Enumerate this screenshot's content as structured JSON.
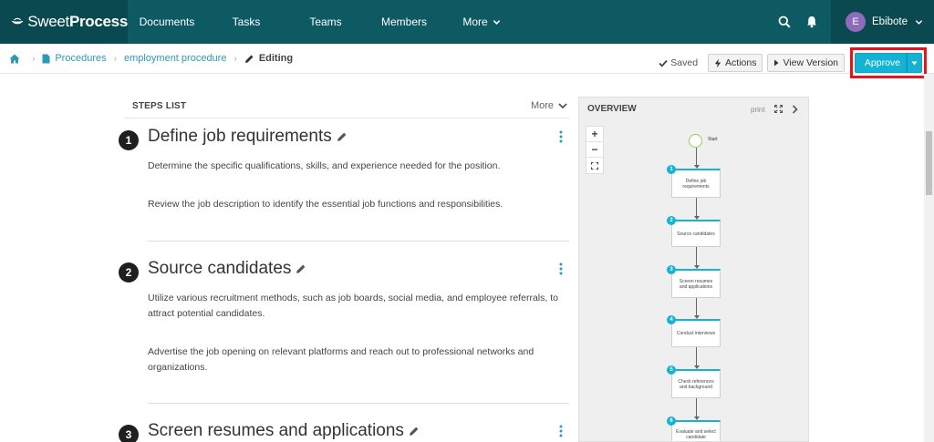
{
  "brand": {
    "name_part1": "Sweet",
    "name_part2": "Process"
  },
  "nav": {
    "documents": "Documents",
    "tasks": "Tasks",
    "teams": "Teams",
    "members": "Members",
    "more": "More"
  },
  "user": {
    "initial": "E",
    "name": "Ebibote"
  },
  "breadcrumb": {
    "procedures": "Procedures",
    "procedure": "employment procedure",
    "current": "Editing"
  },
  "toolbar": {
    "saved": "Saved",
    "actions": "Actions",
    "view_version": "View Version",
    "approve": "Approve"
  },
  "steps_list": {
    "title": "STEPS LIST",
    "more": "More",
    "steps": [
      {
        "number": "1",
        "title": "Define job requirements",
        "paragraphs": [
          "Determine the specific qualifications, skills, and experience needed for the position.",
          "Review the job description to identify the essential job functions and responsibilities."
        ]
      },
      {
        "number": "2",
        "title": "Source candidates",
        "paragraphs": [
          "Utilize various recruitment methods, such as job boards, social media, and employee referrals, to attract potential candidates.",
          "Advertise the job opening on relevant platforms and reach out to professional networks and organizations."
        ]
      },
      {
        "number": "3",
        "title": "Screen resumes and applications",
        "paragraphs": []
      }
    ]
  },
  "overview": {
    "title": "OVERVIEW",
    "print": "print",
    "zoom_in": "+",
    "zoom_out": "−",
    "start_label": "Start",
    "flow": [
      {
        "number": "1",
        "label": "Define job requirements"
      },
      {
        "number": "2",
        "label": "Source candidates"
      },
      {
        "number": "3",
        "label": "Screen resumes and applications"
      },
      {
        "number": "4",
        "label": "Conduct interviews"
      },
      {
        "number": "5",
        "label": "Check references and background"
      },
      {
        "number": "6",
        "label": "Evaluate and select candidate"
      }
    ]
  },
  "colors": {
    "topbar": "#0d5a63",
    "accent": "#14b3d4",
    "highlight_border": "#e8141b"
  }
}
